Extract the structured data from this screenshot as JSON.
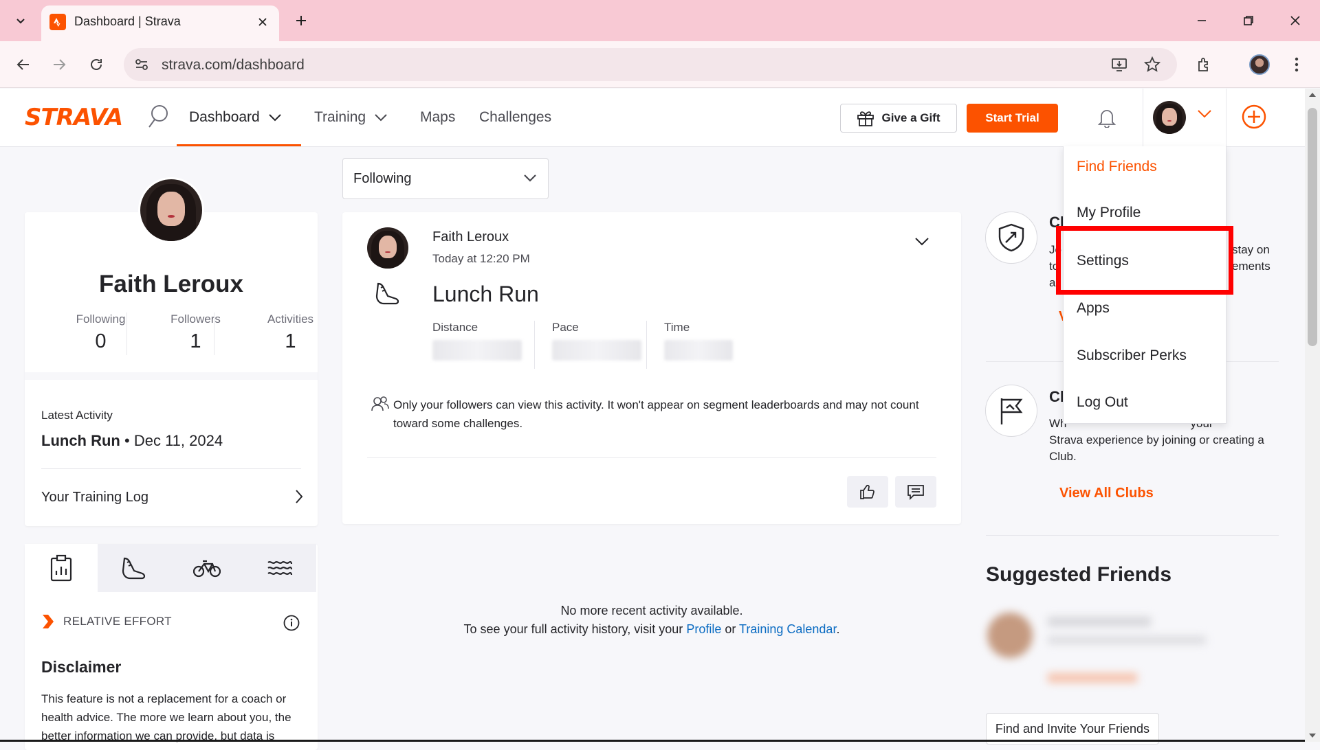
{
  "browser": {
    "tab_title": "Dashboard | Strava",
    "url": "strava.com/dashboard"
  },
  "header": {
    "logo": "STRAVA",
    "nav": [
      "Dashboard",
      "Training",
      "Maps",
      "Challenges"
    ],
    "gift_label": "Give a Gift",
    "trial_label": "Start Trial"
  },
  "profile": {
    "name": "Faith Leroux",
    "stats": [
      {
        "label": "Following",
        "value": "0"
      },
      {
        "label": "Followers",
        "value": "1"
      },
      {
        "label": "Activities",
        "value": "1"
      }
    ],
    "latest_label": "Latest Activity",
    "latest_activity": "Lunch Run",
    "latest_date": "Dec 11, 2024",
    "training_log": "Your Training Log"
  },
  "effort": {
    "title": "RELATIVE EFFORT",
    "disclaimer_title": "Disclaimer",
    "disclaimer_text": "This feature is not a replacement for a coach or health advice. The more we learn about you, the better information we can provide, but data is"
  },
  "feed": {
    "filter": "Following",
    "activity": {
      "athlete": "Faith Leroux",
      "time": "Today at 12:20 PM",
      "title": "Lunch Run",
      "metrics": [
        "Distance",
        "Pace",
        "Time"
      ],
      "privacy_note": "Only your followers can view this activity. It won't appear on segment leaderboards and may not count toward some challenges."
    },
    "no_more": "No more recent activity available.",
    "history_prefix": "To see your full activity history, visit your ",
    "history_link1": "Profile",
    "history_or": " or ",
    "history_link2": "Training Calendar",
    "history_suffix": "."
  },
  "right": {
    "challenges_title_partial": "Cl",
    "challenges_text_left": [
      "Jo",
      "to",
      "a"
    ],
    "challenges_text_right": [
      "stay on",
      "ements"
    ],
    "challenges_link_partial": "V",
    "clubs_title_partial": "Cl",
    "clubs_text": "Why do it alone? Get more out of your Strava experience by joining or creating a Club.",
    "clubs_text_visible_1": "Wh",
    "clubs_text_visible_2": "your",
    "clubs_text_line2": "Strava experience by joining or creating a",
    "clubs_text_line3": "Club.",
    "clubs_link": "View All Clubs",
    "suggested_title": "Suggested Friends",
    "invite_label": "Find and Invite Your Friends"
  },
  "menu": {
    "items": [
      "Find Friends",
      "My Profile",
      "Settings",
      "Apps",
      "Subscriber Perks",
      "Log Out"
    ]
  },
  "colors": {
    "brand": "#fc5200",
    "link": "#0a6bc2",
    "highlight": "#ff0000"
  }
}
